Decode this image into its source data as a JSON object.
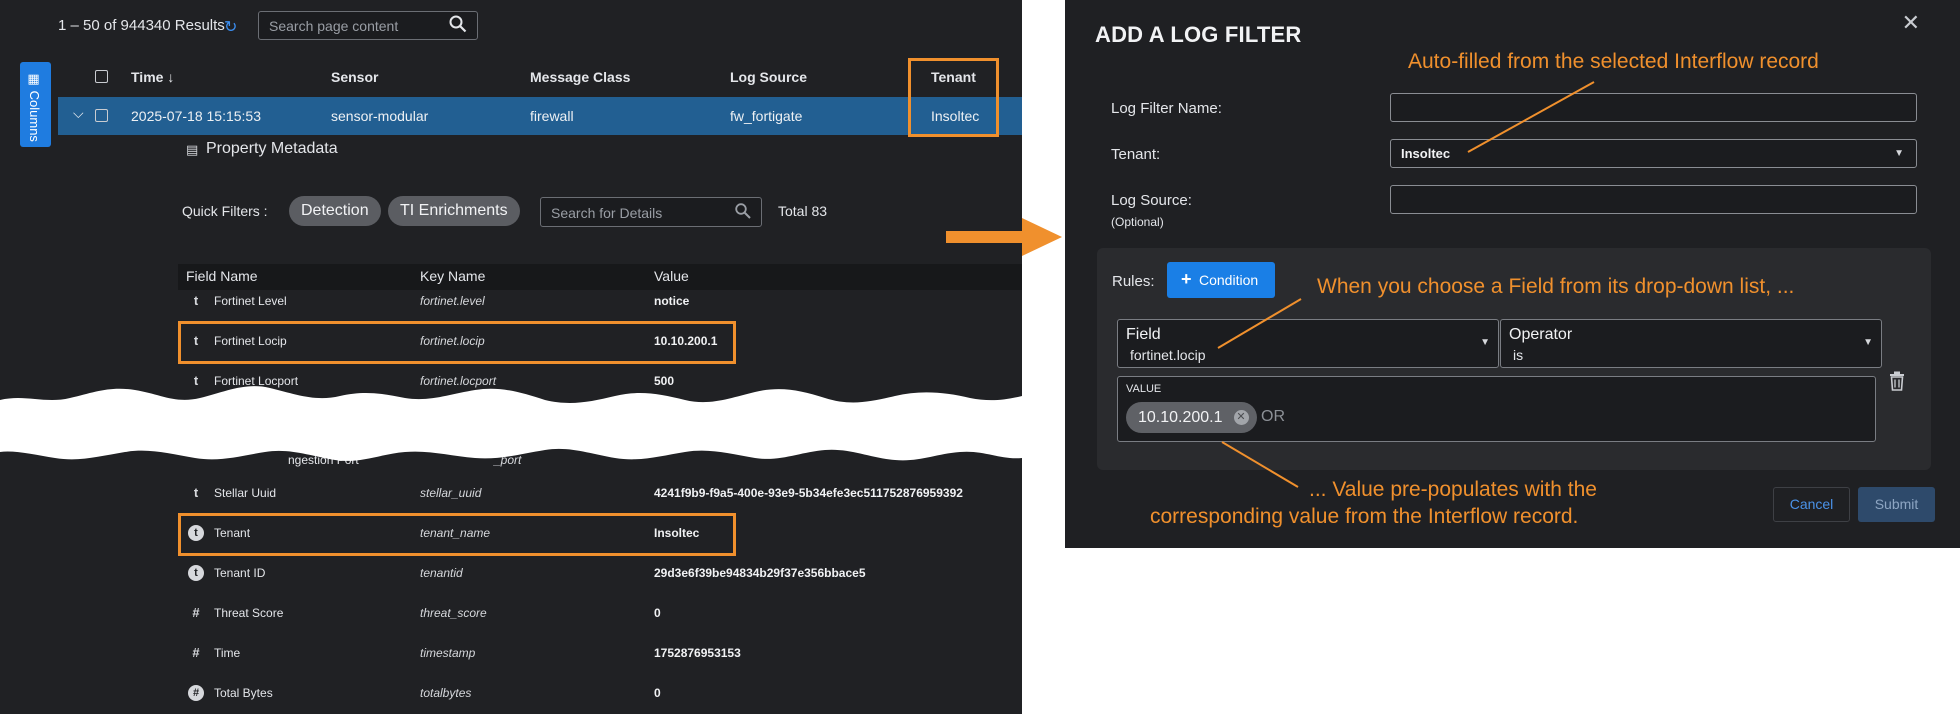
{
  "results": {
    "summary": "1 – 50 of 944340 Results",
    "search_placeholder": "Search page content"
  },
  "columns_tab": {
    "label": "Columns"
  },
  "table": {
    "headers": {
      "time": "Time",
      "sensor": "Sensor",
      "message_class": "Message Class",
      "log_source": "Log Source",
      "tenant": "Tenant"
    },
    "row": {
      "time": "2025-07-18 15:15:53",
      "sensor": "sensor-modular",
      "message_class": "firewall",
      "log_source": "fw_fortigate",
      "tenant": "Insoltec"
    }
  },
  "property_metadata": {
    "title": "Property Metadata",
    "quick_filters_label": "Quick Filters :",
    "quick_filters": [
      "Detection",
      "TI Enrichments"
    ],
    "search_placeholder": "Search for Details",
    "total": "Total 83"
  },
  "details": {
    "headers": {
      "field": "Field Name",
      "key": "Key Name",
      "value": "Value"
    },
    "rows_top": [
      {
        "icon": "t",
        "field": "Fortinet Level",
        "key": "fortinet.level",
        "value": "notice"
      },
      {
        "icon": "t",
        "field": "Fortinet Locip",
        "key": "fortinet.locip",
        "value": "10.10.200.1"
      },
      {
        "icon": "t",
        "field": "Fortinet Locport",
        "key": "fortinet.locport",
        "value": "500"
      }
    ],
    "partial_row": {
      "field": "ngestion Port",
      "key": "_port"
    },
    "rows_bottom": [
      {
        "icon": "t",
        "field": "Stellar Uuid",
        "key": "stellar_uuid",
        "value": "4241f9b9-f9a5-400e-93e9-5b34efe3ec511752876959392"
      },
      {
        "icon": "t-circle",
        "field": "Tenant",
        "key": "tenant_name",
        "value": "Insoltec"
      },
      {
        "icon": "t-circle",
        "field": "Tenant ID",
        "key": "tenantid",
        "value": "29d3e6f39be94834b29f37e356bbace5"
      },
      {
        "icon": "#",
        "field": "Threat Score",
        "key": "threat_score",
        "value": "0"
      },
      {
        "icon": "#",
        "field": "Time",
        "key": "timestamp",
        "value": "1752876953153"
      },
      {
        "icon": "#-circle",
        "field": "Total Bytes",
        "key": "totalbytes",
        "value": "0"
      }
    ]
  },
  "dialog": {
    "title": "ADD A LOG FILTER",
    "log_filter_name_label": "Log Filter Name:",
    "log_filter_name_value": "",
    "tenant_label": "Tenant:",
    "tenant_value": "Insoltec",
    "log_source_label": "Log Source:",
    "log_source_optional": "(Optional)",
    "log_source_value": "",
    "rules_label": "Rules:",
    "condition_button": "Condition",
    "field_label": "Field",
    "field_value": "fortinet.locip",
    "operator_label": "Operator",
    "operator_value": "is",
    "value_label": "VALUE",
    "value_chip": "10.10.200.1",
    "or_label": "OR",
    "cancel": "Cancel",
    "submit": "Submit"
  },
  "annotations": {
    "autofill": "Auto-filled from the selected Interflow record",
    "field_choice": "When you choose a Field from its drop-down list, ...",
    "value_line1": "... Value pre-populates with the",
    "value_line2": "corresponding value from the Interflow record."
  },
  "colors": {
    "highlight": "#f0902d",
    "accent": "#1a7fe6",
    "row_selected": "#225f92"
  }
}
